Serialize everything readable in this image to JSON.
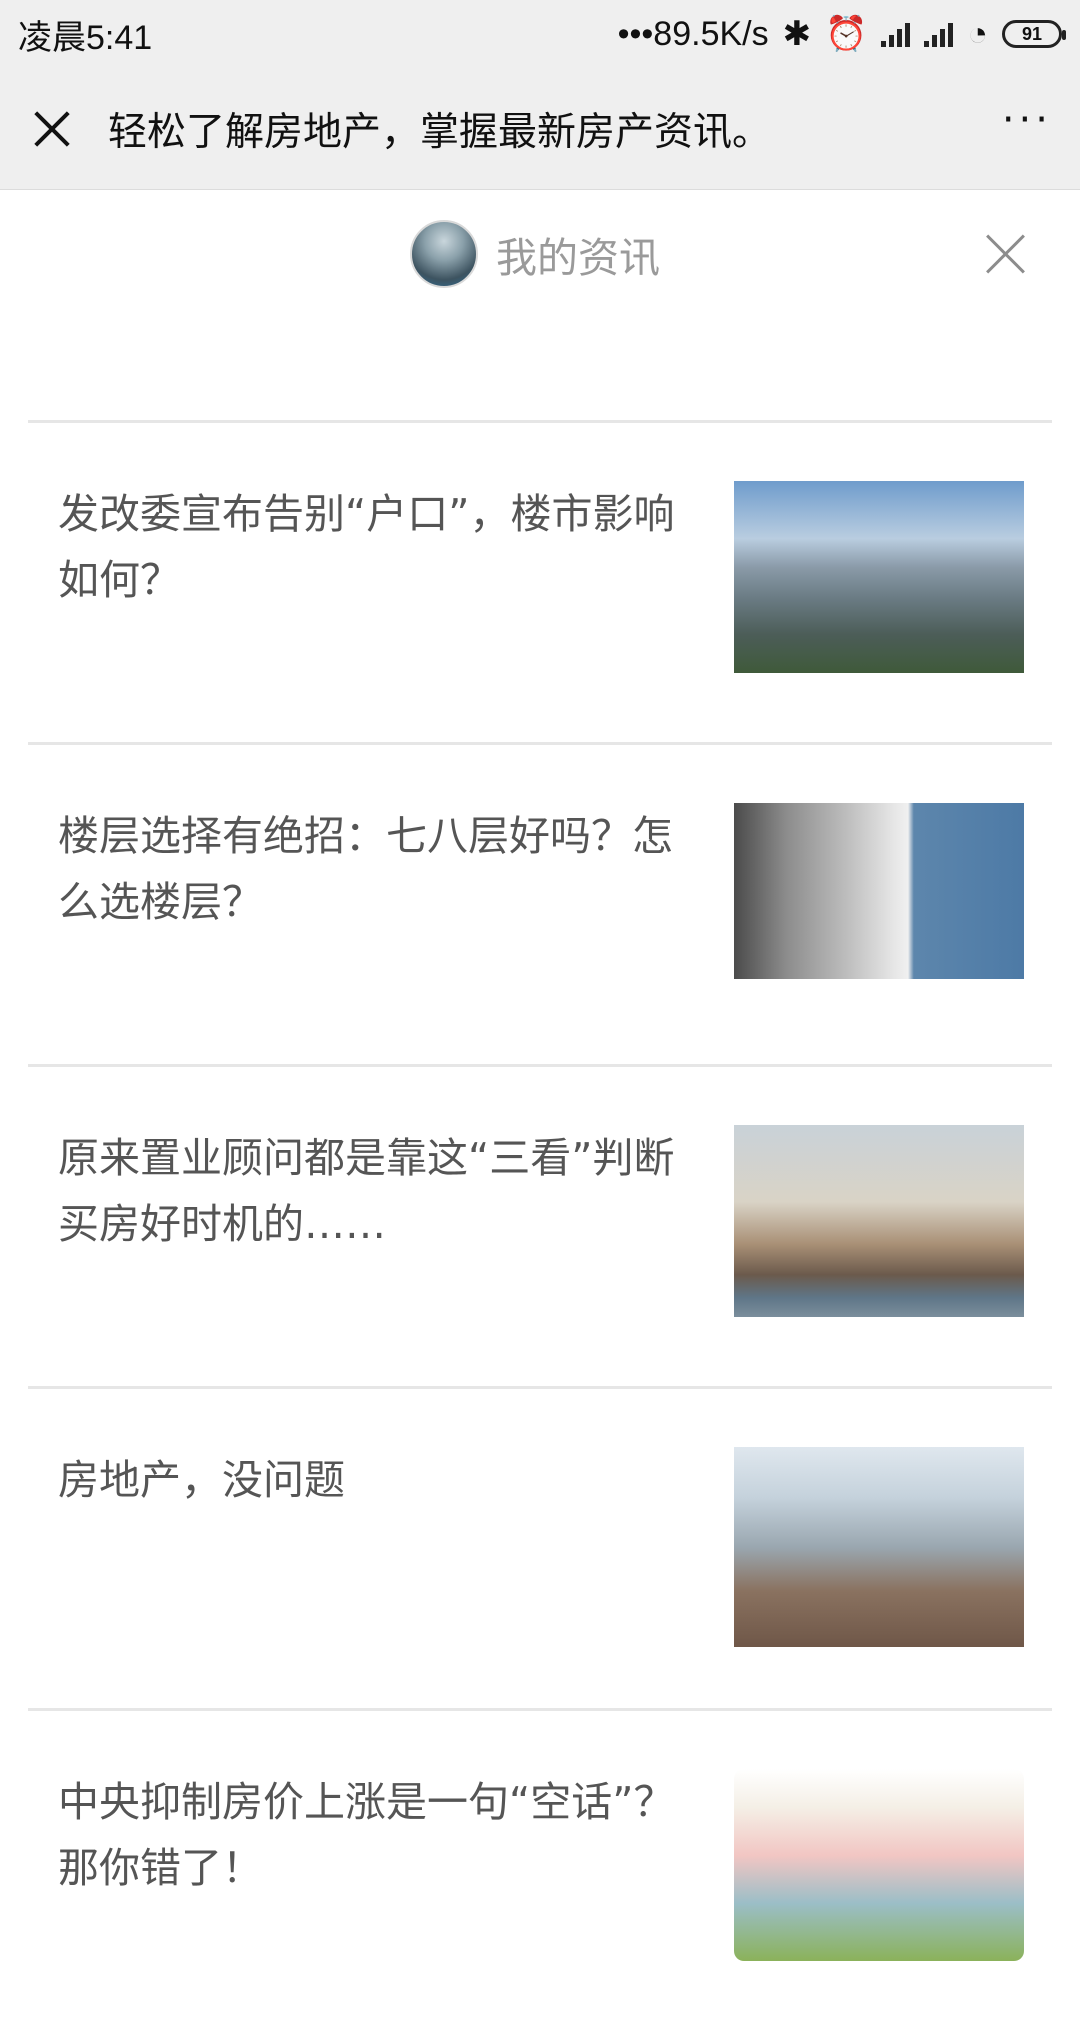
{
  "status_bar": {
    "time": "凌晨5:41",
    "network_speed": "•••89.5K/s",
    "bluetooth_icon": "bluetooth-icon",
    "alarm_icon": "alarm-icon",
    "wifi_icon": "wifi-icon",
    "battery": "91"
  },
  "titlebar": {
    "title": "轻松了解房地产，掌握最新房产资讯。",
    "more": "···"
  },
  "subheader": {
    "title": "我的资讯"
  },
  "articles": [
    {
      "title": "发改委宣布告别“户口”，楼市影响如何？",
      "thumb_icon": "city-aerial-image"
    },
    {
      "title": "楼层选择有绝招：七八层好吗？怎么选楼层？",
      "thumb_icon": "building-facade-image"
    },
    {
      "title": "原来置业顾问都是靠这“三看”判断买房好时机的……",
      "thumb_icon": "skyline-image"
    },
    {
      "title": "房地产，没问题",
      "thumb_icon": "cityscape-image"
    },
    {
      "title": "中央抑制房价上涨是一句“空话”？那你错了！",
      "thumb_icon": "chart-illustration-image"
    }
  ]
}
